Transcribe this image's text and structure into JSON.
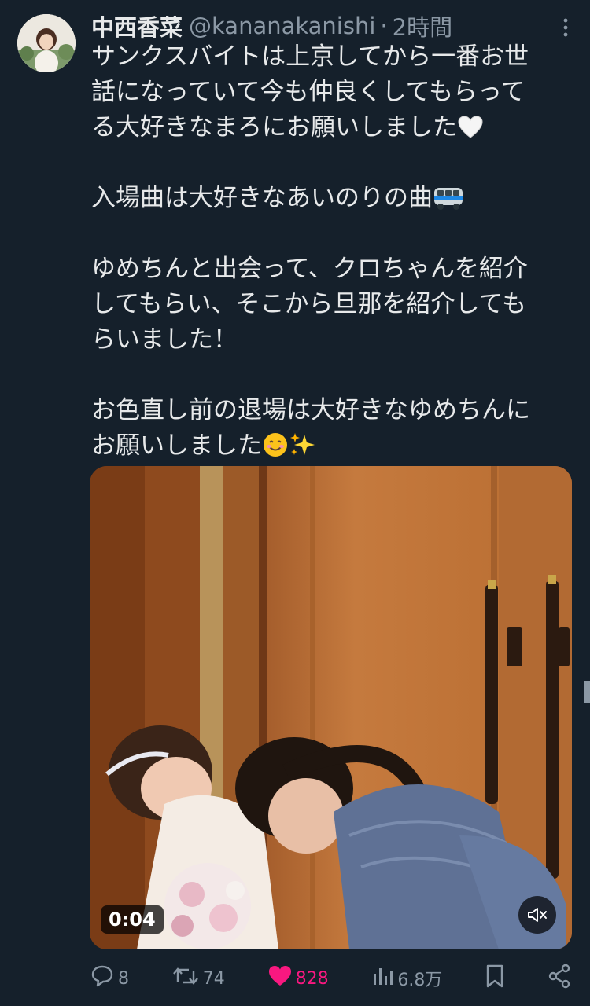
{
  "author": {
    "display_name": "中西香菜",
    "handle": "@kananakanishi",
    "separator": "·",
    "timestamp": "2時間"
  },
  "tweet": {
    "lines": [
      "サンクスバイトは上京してから一番お世",
      "話になっていて今も仲良くしてもらって",
      "る大好きなまろにお願いしました",
      "",
      "入場曲は大好きなあいのりの曲",
      "",
      "ゆめちんと出会って、クロちゃんを紹介",
      "してもらい、そこから旦那を紹介しても",
      "らいました！",
      "",
      "お色直し前の退場は大好きなゆめちんに",
      "お願いしました"
    ],
    "emojis": {
      "line2": "white-heart-emoji",
      "line4": "bus-emoji",
      "line11": [
        "smiling-face-emoji",
        "sparkles-emoji"
      ]
    }
  },
  "media": {
    "type": "video",
    "duration": "0:04",
    "muted": true
  },
  "actions": {
    "replies": "8",
    "retweets": "74",
    "likes": "828",
    "views": "6.8万",
    "liked": true
  },
  "colors": {
    "background": "#15202b",
    "text": "#e7e9ea",
    "secondary": "#8b98a5",
    "like": "#f91880"
  }
}
